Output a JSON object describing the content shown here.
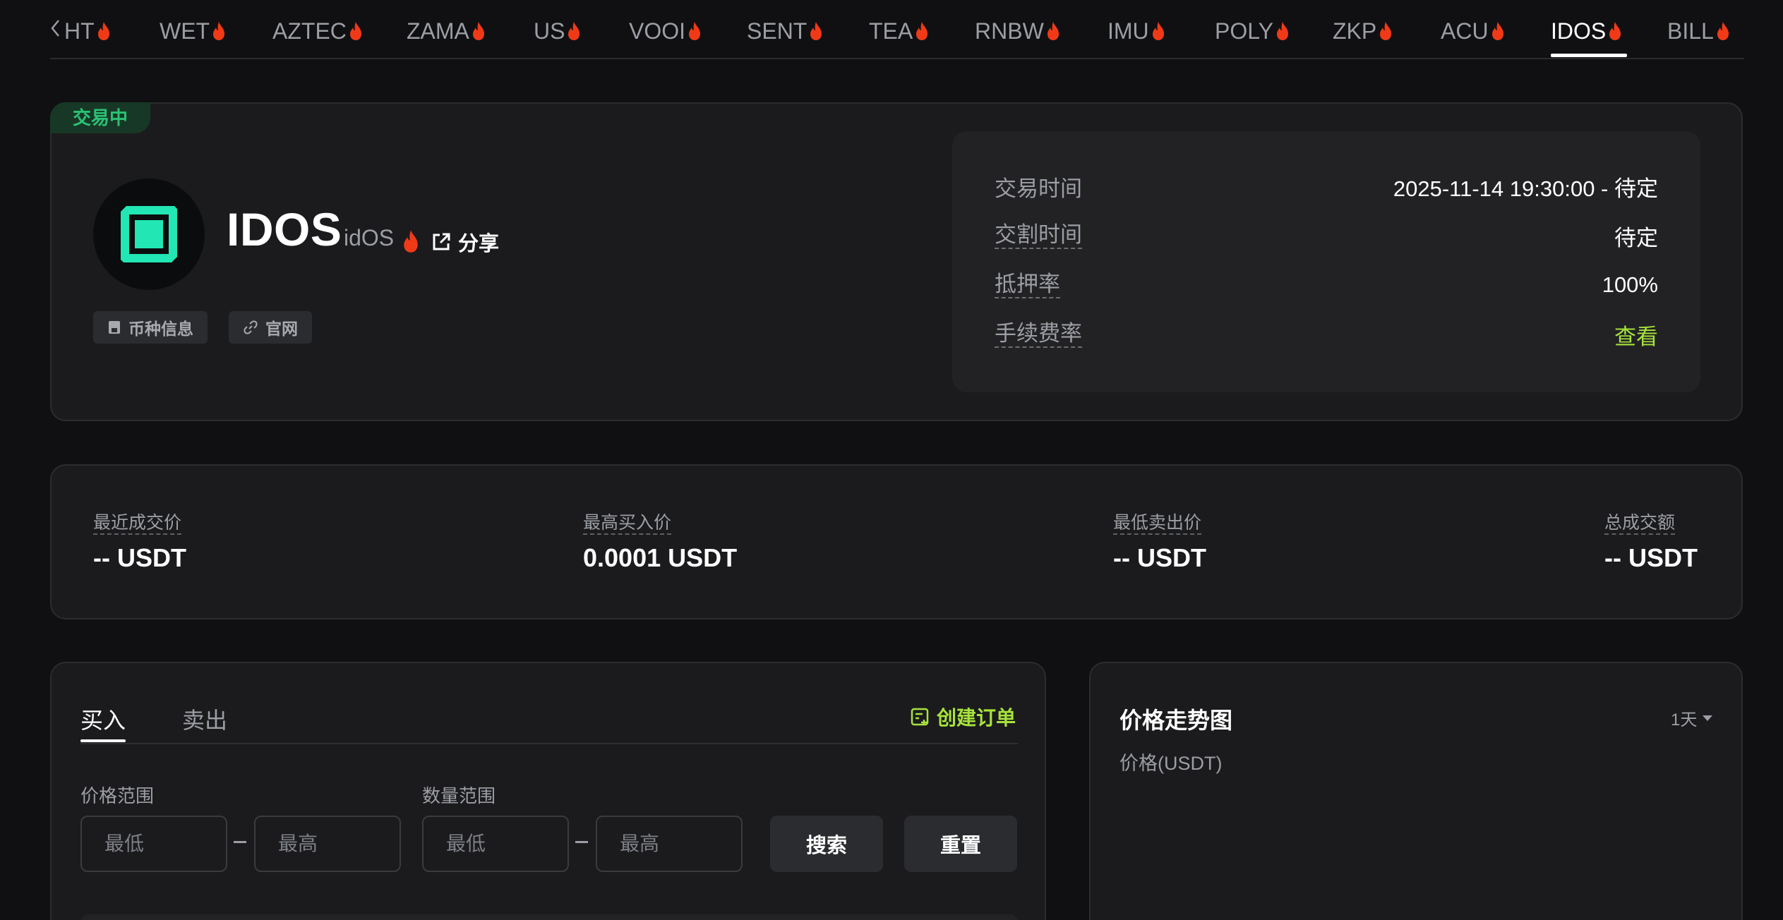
{
  "tabs": [
    {
      "label": "HT",
      "active": false
    },
    {
      "label": "WET",
      "active": false
    },
    {
      "label": "AZTEC",
      "active": false
    },
    {
      "label": "ZAMA",
      "active": false
    },
    {
      "label": "US",
      "active": false
    },
    {
      "label": "VOOI",
      "active": false
    },
    {
      "label": "SENT",
      "active": false
    },
    {
      "label": "TEA",
      "active": false
    },
    {
      "label": "RNBW",
      "active": false
    },
    {
      "label": "IMU",
      "active": false
    },
    {
      "label": "POLY",
      "active": false
    },
    {
      "label": "ZKP",
      "active": false
    },
    {
      "label": "ACU",
      "active": false
    },
    {
      "label": "IDOS",
      "active": true
    },
    {
      "label": "BILL",
      "active": false
    }
  ],
  "token": {
    "status": "交易中",
    "symbol": "IDOS",
    "name": "idOS",
    "share_label": "分享",
    "chips": {
      "info": "币种信息",
      "website": "官网"
    }
  },
  "info": {
    "trade_time_label": "交易时间",
    "trade_time_value": "2025-11-14 19:30:00 - 待定",
    "delivery_time_label": "交割时间",
    "delivery_time_value": "待定",
    "collateral_label": "抵押率",
    "collateral_value": "100%",
    "fee_label": "手续费率",
    "fee_value": "查看"
  },
  "stats": {
    "last_price_label": "最近成交价",
    "last_price_value": "-- USDT",
    "best_bid_label": "最高买入价",
    "best_bid_value": "0.0001 USDT",
    "best_ask_label": "最低卖出价",
    "best_ask_value": "-- USDT",
    "volume_label": "总成交额",
    "volume_value": "-- USDT"
  },
  "orders": {
    "buy_tab": "买入",
    "sell_tab": "卖出",
    "create_order": "创建订单",
    "price_range_label": "价格范围",
    "qty_range_label": "数量范围",
    "min_placeholder": "最低",
    "max_placeholder": "最高",
    "search_button": "搜索",
    "reset_button": "重置"
  },
  "chart": {
    "title": "价格走势图",
    "period": "1天",
    "unit_label": "价格(USDT)"
  },
  "colors": {
    "accent_green": "#a7e33c",
    "status_green": "#2bc275",
    "fire": "#f03a17",
    "logo_teal": "#22e6b4"
  },
  "icons": {
    "fire": "fire-icon",
    "share": "external-link-icon",
    "info": "document-icon",
    "website": "link-icon",
    "create_order": "add-order-icon"
  }
}
